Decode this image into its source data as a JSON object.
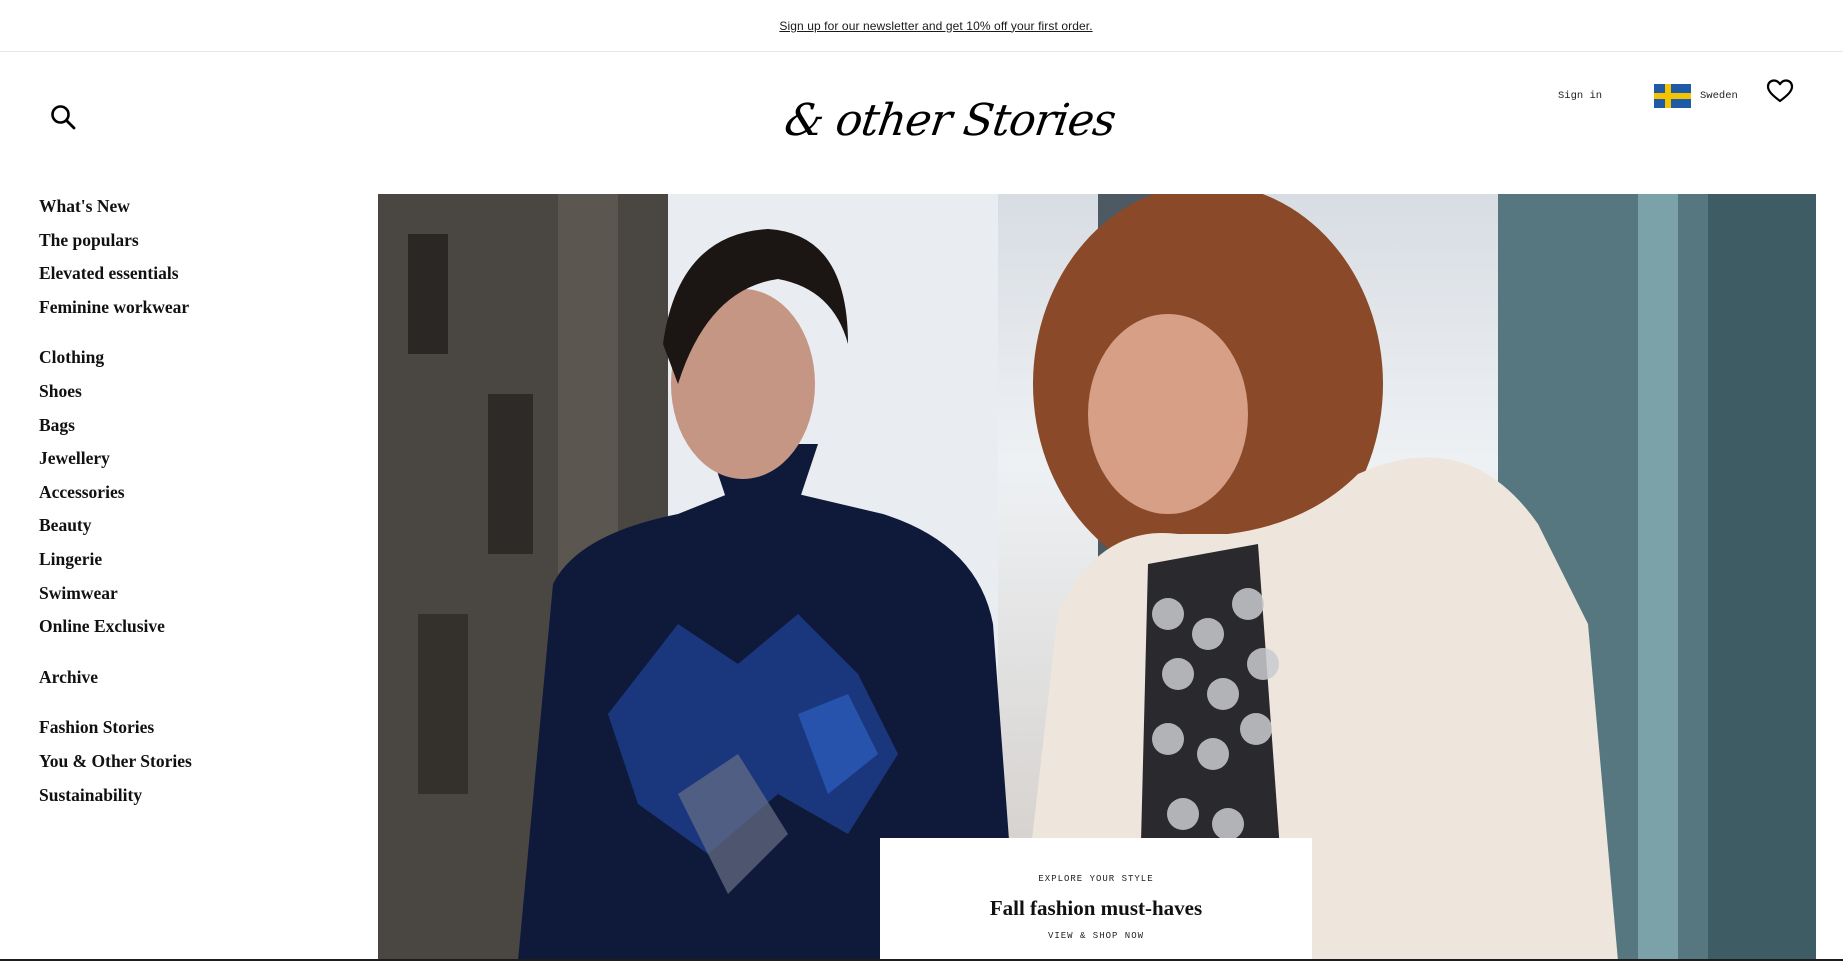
{
  "promo": {
    "text": "Sign up for our newsletter and get 10% off your first order."
  },
  "header": {
    "logo_text": "& other Stories",
    "sign_in_label": "Sign in",
    "country_label": "Sweden",
    "icons": {
      "search": "search-icon",
      "wishlist": "heart-icon",
      "flag": "sweden-flag-icon"
    }
  },
  "sidebar": {
    "groups": [
      {
        "items": [
          "What's New",
          "The populars",
          "Elevated essentials",
          "Feminine workwear"
        ]
      },
      {
        "items": [
          "Clothing",
          "Shoes",
          "Bags",
          "Jewellery",
          "Accessories",
          "Beauty",
          "Lingerie",
          "Swimwear",
          "Online Exclusive"
        ]
      },
      {
        "items": [
          "Archive"
        ]
      },
      {
        "items": [
          "Fashion Stories",
          "You & Other Stories",
          "Sustainability"
        ]
      }
    ]
  },
  "hero": {
    "eyebrow": "EXPLORE YOUR STYLE",
    "title": "Fall fashion must-haves",
    "cta": "VIEW & SHOP NOW"
  },
  "colors": {
    "text": "#111111",
    "flag_blue": "#1f5aa6",
    "flag_yellow": "#f5c400"
  }
}
